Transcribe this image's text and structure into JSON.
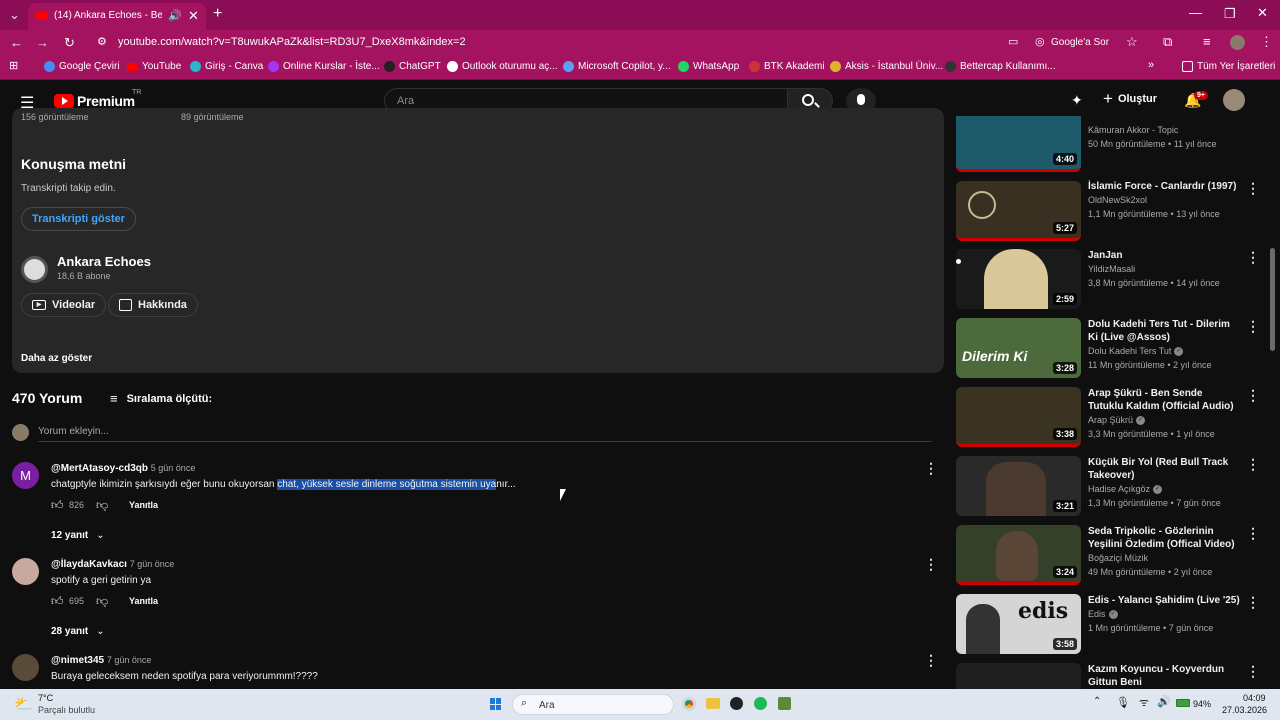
{
  "browser": {
    "tab_title": "(14) Ankara Echoes - Beni A",
    "url": "youtube.com/watch?v=T8uwukAPaZk&list=RD3U7_DxeX8mk&index=2",
    "google_sor": "Google'a Sor",
    "bookmarks": [
      "Google Çeviri",
      "YouTube",
      "Giriş - Canva",
      "Online Kurslar - İste...",
      "ChatGPT",
      "Outlook oturumu aç...",
      "Microsoft Copilot, y...",
      "WhatsApp",
      "BTK Akademi",
      "Aksis - İstanbul Üniv...",
      "Bettercap Kullanımı..."
    ],
    "all_bookmarks": "Tüm Yer İşaretleri"
  },
  "yt_header": {
    "logo": "Premium",
    "region": "TR",
    "search_placeholder": "Ara",
    "create": "Oluştur",
    "notif_badge": "9+"
  },
  "description": {
    "views_left": "156 görüntüleme",
    "views_right": "89 görüntüleme",
    "transcript_title": "Konuşma metni",
    "transcript_sub": "Transkripti takip edin.",
    "transcript_btn": "Transkripti göster",
    "channel_name": "Ankara Echoes",
    "subscribers": "18,6 B abone",
    "videos_btn": "Videolar",
    "about_btn": "Hakkında",
    "less": "Daha az göster"
  },
  "comments": {
    "count": "470 Yorum",
    "sort": "Sıralama ölçütü:",
    "add_placeholder": "Yorum ekleyin...",
    "reply_label": "Yanıtla",
    "items": [
      {
        "user": "@MertAtasoy-cd3qb",
        "time": "5 gün önce",
        "text_a": "chatgptyle ikimizin şarkısıydı eğer bunu okuyorsan ",
        "text_b": "chat, yüksek sesle dinleme soğutma sistemin uya",
        "text_c": "nır...",
        "likes": "826",
        "replies": "12 yanıt"
      },
      {
        "user": "@İlaydaKavkacı",
        "time": "7 gün önce",
        "text": "spotify a geri getirin ya",
        "likes": "695",
        "replies": "28 yanıt"
      },
      {
        "user": "@nimet345",
        "time": "7 gün önce",
        "text": "Buraya geleceksem neden spotifya para veriyorummm!????"
      }
    ]
  },
  "rail": [
    {
      "title": "",
      "channel": "Kâmuran Akkor - Topic",
      "meta": "50 Mn görüntüleme • 11 yıl önce",
      "dur": "4:40",
      "color": "#1e5a6a"
    },
    {
      "title": "İslamic Force - Canlardır (1997)",
      "channel": "OldNewSk2xol",
      "meta": "1,1 Mn görüntüleme • 13 yıl önce",
      "dur": "5:27",
      "color": "#3a3022"
    },
    {
      "title": "JanJan",
      "channel": "YildizMasali",
      "meta": "3,8 Mn görüntüleme • 14 yıl önce",
      "dur": "2:59",
      "color": "#d8c89a"
    },
    {
      "title": "Dolu Kadehi Ters Tut - Dilerim Ki (Live @Assos)",
      "channel": "Dolu Kadehi Ters Tut",
      "meta": "11 Mn görüntüleme • 2 yıl önce",
      "dur": "3:28",
      "color": "#4c6a3c"
    },
    {
      "title": "Arap Şükrü - Ben Sende Tutuklu Kaldım (Official Audio)",
      "channel": "Arap Şükrü",
      "meta": "3,3 Mn görüntüleme • 1 yıl önce",
      "dur": "3:38",
      "color": "#3a3322"
    },
    {
      "title": "Küçük Bir Yol (Red Bull Track Takeover)",
      "channel": "Hadise Açıkgöz",
      "meta": "1,3 Mn görüntüleme • 7 gün önce",
      "dur": "3:21",
      "color": "#2a2a2a"
    },
    {
      "title": "Seda Tripkolic - Gözlerinin Yeşilini Özledim (Offical Video)",
      "channel": "Boğaziçi Müzik",
      "meta": "49 Mn görüntüleme • 2 yıl önce",
      "dur": "3:24",
      "color": "#35402a"
    },
    {
      "title": "Edis - Yalancı Şahidim (Live '25)",
      "channel": "Edis",
      "meta": "1 Mn görüntüleme • 7 gün önce",
      "dur": "3:58",
      "color": "#d5d5d5"
    },
    {
      "title": "Kazım Koyuncu - Koyverdun Gittun Beni",
      "channel": "",
      "meta": "",
      "dur": "",
      "color": "#1f1f1f"
    }
  ],
  "taskbar": {
    "temp": "7°C",
    "weather": "Parçalı bulutlu",
    "search": "Ara",
    "battery": "94%",
    "time": "04:09",
    "date": "27.03.2026"
  }
}
